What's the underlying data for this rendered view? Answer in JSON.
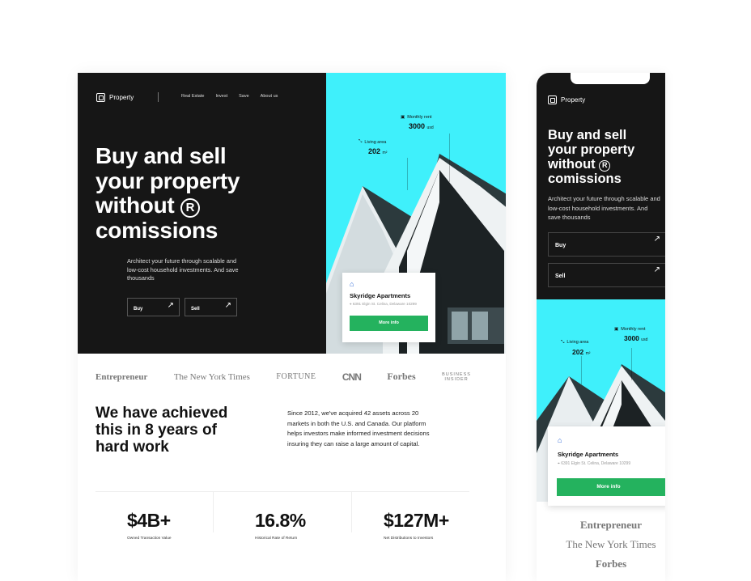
{
  "brand": {
    "name": "Property"
  },
  "nav": {
    "items": [
      "Real Estate",
      "Invest",
      "Save",
      "About us"
    ]
  },
  "hero": {
    "title_lines": [
      "Buy and sell",
      "your property",
      "without",
      "comissions"
    ],
    "reg_symbol": "R",
    "description": "Architect your future through scalable and low-cost household investments. And save thousands",
    "buy_label": "Buy",
    "sell_label": "Sell",
    "arrow": "↗"
  },
  "listing": {
    "rent_label": "Monthly rent",
    "rent_value": "3000",
    "rent_unit": "usd",
    "area_label": "Living area",
    "area_value": "202",
    "area_unit": "m²",
    "name": "Skyridge Apartments",
    "address": "6391 Elgin St. Celina, Delaware 10299",
    "button": "More info"
  },
  "press": [
    "Entrepreneur",
    "The New York Times",
    "FORTUNE",
    "CNN",
    "Forbes",
    "BUSINESS",
    "INSIDER"
  ],
  "achievement": {
    "title": "We have achieved this in 8 years of hard work",
    "text": "Since 2012, we've acquired 42 assets across 20 markets in both the U.S. and Canada. Our platform helps investors make informed investment decisions insuring they can raise a large amount of capital."
  },
  "stats": [
    {
      "value": "$4B+",
      "label": "Owned Transaction Value"
    },
    {
      "value": "16.8%",
      "label": "Historical Rate of Return"
    },
    {
      "value": "$127M+",
      "label": "Net Distributions to Investors"
    }
  ],
  "colors": {
    "dark": "#161616",
    "cyan": "#3ff0fb",
    "green": "#24b25e",
    "accent_blue": "#2863d6"
  },
  "icons": [
    "logo-icon",
    "ruler-icon",
    "calendar-icon",
    "location-pin-icon",
    "house-icon",
    "arrow-up-right-icon"
  ]
}
